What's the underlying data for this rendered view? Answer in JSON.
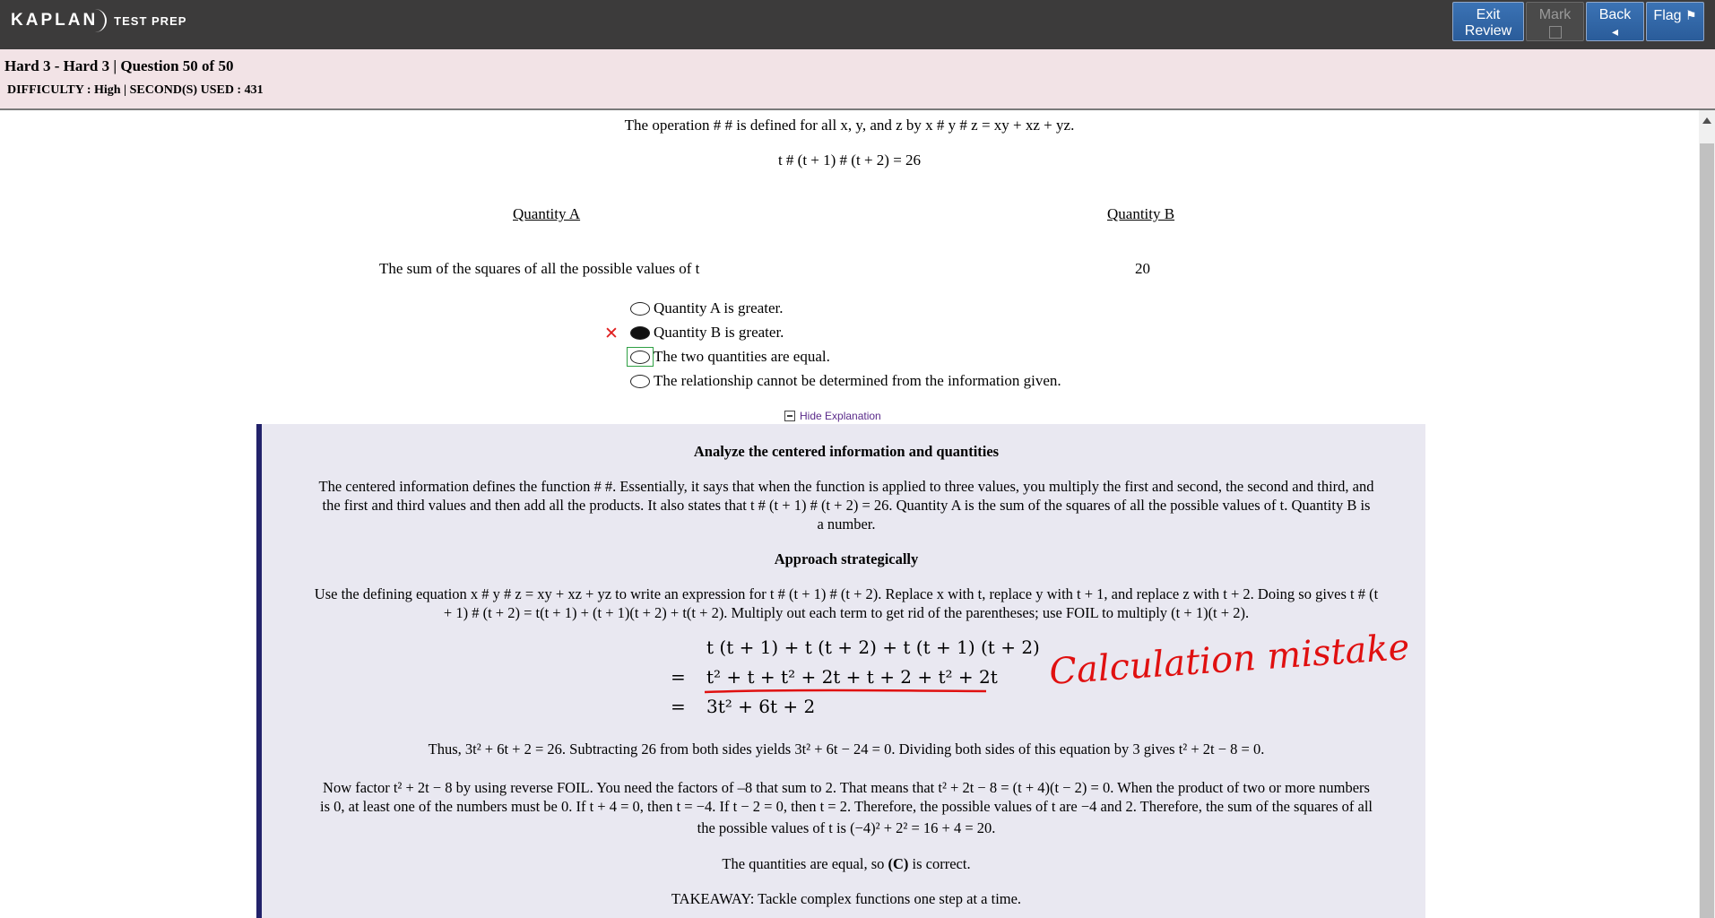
{
  "header": {
    "logo_main": "KAPLAN",
    "logo_sub": "TEST PREP",
    "buttons": {
      "exit_line1": "Exit",
      "exit_line2": "Review",
      "mark_label": "Mark",
      "back_label": "Back",
      "back_icon": "◂",
      "flag_label": "Flag",
      "flag_icon": "⚑"
    }
  },
  "info": {
    "title": "Hard 3 - Hard 3 | Question 50 of 50",
    "meta": "DIFFICULTY : High | SECOND(S) USED : 431"
  },
  "question": {
    "definition": "The operation # # is defined for all x, y, and z by x # y # z = xy + xz + yz.",
    "equation": "t # (t + 1) # (t + 2) = 26",
    "quantity_a_header": "Quantity A",
    "quantity_b_header": "Quantity B",
    "quantity_a": "The sum of the squares of all the possible values of t",
    "quantity_b": "20",
    "wrong_mark": "✕",
    "choices": [
      {
        "label": "Quantity A is greater.",
        "selected": false
      },
      {
        "label": "Quantity B is greater.",
        "selected": true
      },
      {
        "label": "The two quantities are equal.",
        "selected": false
      },
      {
        "label": "The relationship cannot be determined from the information given.",
        "selected": false
      }
    ],
    "hide_explanation": "Hide Explanation"
  },
  "explanation": {
    "heading1": "Analyze the centered information and quantities",
    "para1_line1": "The centered information defines the function # #. Essentially, it says that when the function is applied to three values, you multiply the first and second, the second and third, and",
    "para1_line2": "the first and third values and then add all the products. It also states that t # (t + 1) # (t + 2) = 26. Quantity A is the sum of the squares of all the possible values of t. Quantity B is",
    "para1_line3": "a number.",
    "heading2": "Approach strategically",
    "para2_line1": "Use the defining equation x # y # z = xy + xz + yz to write an expression for t # (t + 1) # (t + 2). Replace x with t, replace y with t + 1, and replace z with t + 2. Doing so gives t # (t",
    "para2_line2": "+ 1) # (t + 2) = t(t + 1) + (t + 1)(t + 2) + t(t + 2). Multiply out each term to get rid of the parentheses; use FOIL to multiply (t + 1)(t + 2).",
    "eq1": "t (t + 1) + t (t + 2) + t (t + 1)  (t + 2)",
    "eq2_sign": "=",
    "eq2": "t² + t + t² + 2t + t + 2 + t² + 2t",
    "eq3_sign": "=",
    "eq3": "3t² + 6t + 2",
    "para3": "Thus, 3t² + 6t + 2 = 26. Subtracting 26 from both sides yields 3t² + 6t − 24 = 0. Dividing both sides of this equation by 3 gives t² + 2t − 8 = 0.",
    "para4_line1": "Now factor t² + 2t − 8 by using reverse FOIL. You need the factors of –8 that sum to 2. That means that t² + 2t − 8 = (t + 4)(t − 2) = 0. When the product of two or more numbers",
    "para4_line2": "is 0, at least one of the numbers must be 0. If t + 4 = 0, then t = −4. If t − 2 = 0, then t = 2. Therefore, the possible values of t are −4 and 2. Therefore, the sum of the squares of all",
    "para4_line3": "the possible values of t is (−4)² + 2² = 16 + 4 = 20.",
    "para5_pre": "The quantities are equal, so ",
    "para5_bold": "(C)",
    "para5_post": " is correct.",
    "para6": "TAKEAWAY: Tackle complex functions one step at a time.",
    "annotation": "Calculation mistake"
  }
}
